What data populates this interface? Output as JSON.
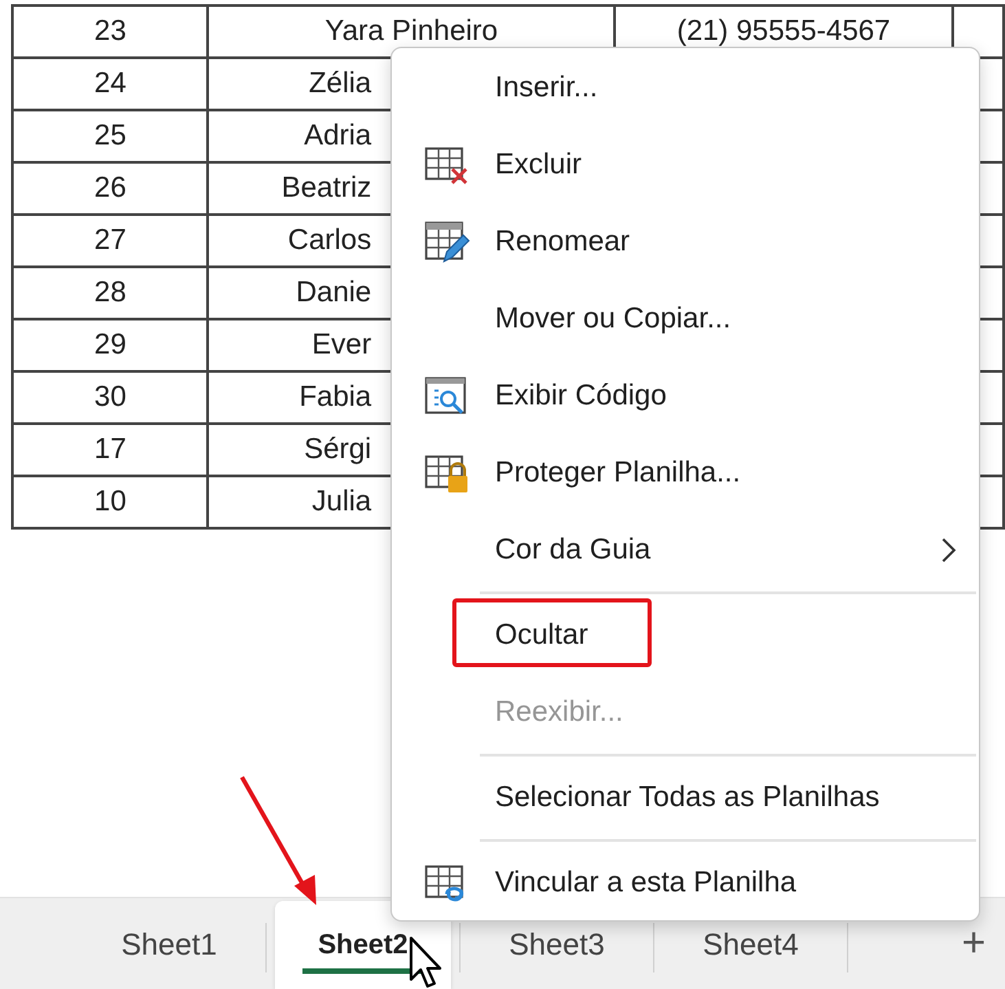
{
  "table": {
    "rows": [
      {
        "id": "23",
        "name": "Yara Pinheiro",
        "phone": "(21) 95555-4567",
        "clipped": false
      },
      {
        "id": "24",
        "name": "Zélia",
        "clipped": true
      },
      {
        "id": "25",
        "name": "Adria",
        "clipped": true
      },
      {
        "id": "26",
        "name": "Beatriz",
        "clipped": true
      },
      {
        "id": "27",
        "name": "Carlos",
        "clipped": true
      },
      {
        "id": "28",
        "name": "Danie",
        "clipped": true
      },
      {
        "id": "29",
        "name": "Ever",
        "clipped": true
      },
      {
        "id": "30",
        "name": "Fabia",
        "clipped": true
      },
      {
        "id": "17",
        "name": "Sérgi",
        "clipped": true
      },
      {
        "id": "10",
        "name": "Julia",
        "clipped": true
      }
    ]
  },
  "context_menu": {
    "items": [
      {
        "kind": "item",
        "label": "Inserir...",
        "disabled": false
      },
      {
        "kind": "item",
        "label": "Excluir",
        "disabled": false
      },
      {
        "kind": "item",
        "label": "Renomear",
        "disabled": false
      },
      {
        "kind": "item",
        "label": "Mover ou Copiar...",
        "disabled": false
      },
      {
        "kind": "item",
        "label": "Exibir Código",
        "disabled": false
      },
      {
        "kind": "item",
        "label": "Proteger Planilha...",
        "disabled": false
      },
      {
        "kind": "item",
        "label": "Cor da Guia",
        "disabled": false,
        "has_submenu": true
      },
      {
        "kind": "separator"
      },
      {
        "kind": "item",
        "label": "Ocultar",
        "disabled": false,
        "highlighted": true
      },
      {
        "kind": "item",
        "label": "Reexibir...",
        "disabled": true
      },
      {
        "kind": "separator"
      },
      {
        "kind": "item",
        "label": "Selecionar Todas as Planilhas",
        "disabled": false
      },
      {
        "kind": "separator"
      },
      {
        "kind": "item",
        "label": "Vincular a esta Planilha",
        "disabled": false
      }
    ]
  },
  "sheet_tabs": [
    {
      "label": "Sheet1",
      "selected": false
    },
    {
      "label": "Sheet2",
      "selected": true
    },
    {
      "label": "Sheet3",
      "selected": false
    },
    {
      "label": "Sheet4",
      "selected": false
    }
  ],
  "add_sheet": "+"
}
